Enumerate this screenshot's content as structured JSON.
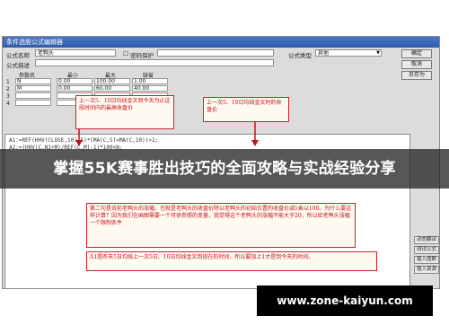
{
  "window": {
    "title": "条件选股公式编辑器",
    "formula_name_label": "公式名称",
    "formula_name_value": "老鸭头",
    "password_label": "密码保护",
    "type_label": "公式类型",
    "type_value": "其他",
    "desc_label": "公式描述",
    "ok_label": "确定",
    "cancel_label": "取消",
    "save_label": "另存为"
  },
  "params": {
    "headers": [
      "参数名",
      "最小",
      "最大",
      "缺省"
    ],
    "rows": [
      [
        "N",
        "0.00",
        "100.00",
        "1.00"
      ],
      [
        "M",
        "0.00",
        "60.00",
        "40.00"
      ],
      [
        "",
        "",
        "",
        ""
      ],
      [
        "",
        "",
        "",
        ""
      ]
    ]
  },
  "code": {
    "line1": "A1:=REF(HHV(CLOSE,10),5)*(MA(C,5)>MA(C,10))>1;",
    "line2": "A2:=(HHV(C,N1+M)/REF(C,M)-1)*100<N;"
  },
  "notes": {
    "n1": "上一次5、10日均线金叉到今天为止这段时间内的最高收盘价",
    "n2": "上一次5、10日均线金叉时的收盘价",
    "n3": "第二句是说前老鸭头的涨幅，也就是老鸭头的收盘价除以老鸭头的初始位置的收盘价减1乘以100。为什么要这样计算？因为我们在画图需要一个可供参照的变量，我觉得这个老鸭头的涨幅不能大于20，所以给老鸭头涨幅一个限制条件",
    "n4": "A1是昨天5日均线上一次5日、10日均线金叉到现在的时间，所以要加上1才是到今天的时间。"
  },
  "side": {
    "b1": "动态翻译",
    "b2": "测试公式",
    "b3": "插入函数",
    "b4": "插入资源"
  },
  "banner": "掌握55K赛事胜出技巧的全面攻略与实战经验分享",
  "watermark": "www.zone-kaiyun.com"
}
